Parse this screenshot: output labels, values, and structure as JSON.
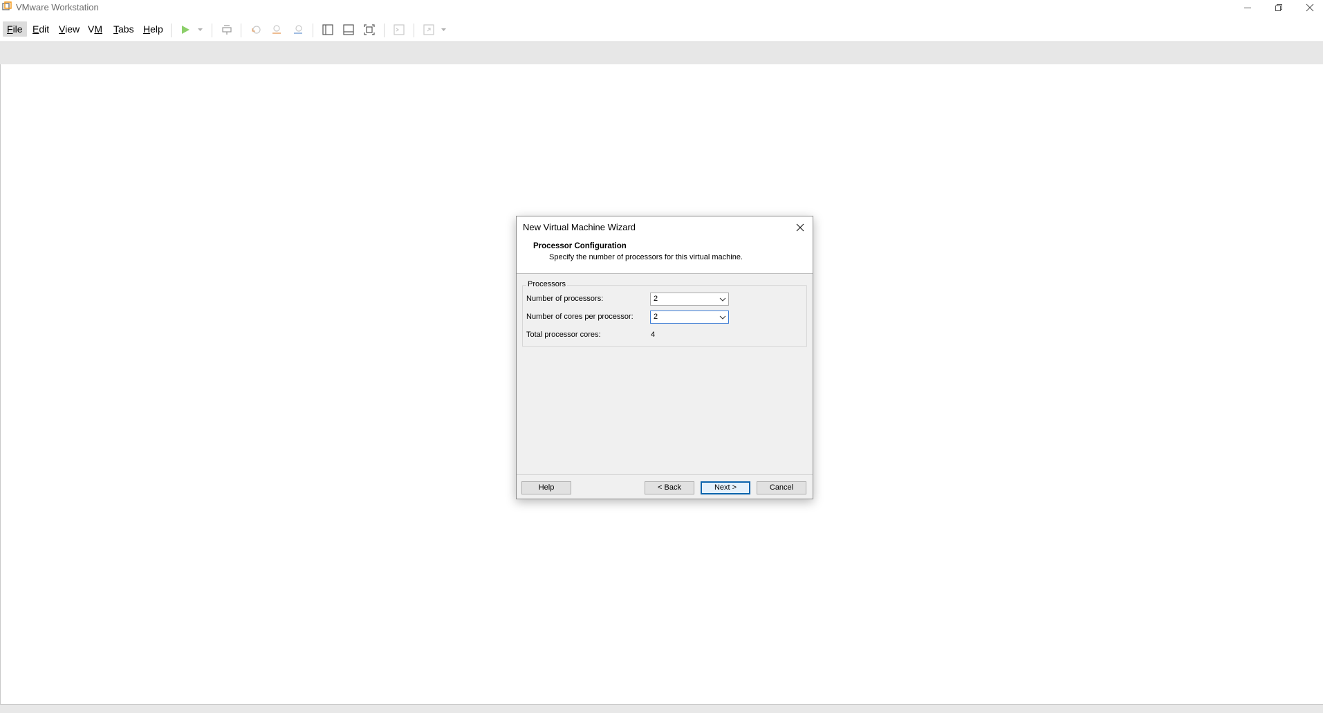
{
  "window": {
    "title": "VMware Workstation"
  },
  "menu": {
    "items": [
      {
        "label": "File",
        "mnemonic": "F",
        "rest": "ile"
      },
      {
        "label": "Edit",
        "mnemonic": "E",
        "rest": "dit"
      },
      {
        "label": "View",
        "mnemonic": "V",
        "rest": "iew"
      },
      {
        "label": "VM",
        "mnemonic": "M",
        "rest": "",
        "prefix": "V"
      },
      {
        "label": "Tabs",
        "mnemonic": "T",
        "rest": "abs"
      },
      {
        "label": "Help",
        "mnemonic": "H",
        "rest": "elp"
      }
    ]
  },
  "toolbar": {
    "icons": [
      "play-icon",
      "send-keys-icon",
      "snapshot-revert-icon",
      "snapshot-take-icon",
      "snapshot-manager-icon",
      "library-icon",
      "thumbnail-icon",
      "fullscreen-icon",
      "console-icon",
      "unity-icon"
    ],
    "accent": "#6cb33f"
  },
  "dialog": {
    "title": "New Virtual Machine Wizard",
    "heading": "Processor Configuration",
    "subheading": "Specify the number of processors for this virtual machine.",
    "group_label": "Processors",
    "fields": {
      "processors_label": "Number of processors:",
      "processors_value": "2",
      "cores_label": "Number of cores per processor:",
      "cores_value": "2",
      "total_label": "Total processor cores:",
      "total_value": "4"
    },
    "buttons": {
      "help": "Help",
      "back": "< Back",
      "next": "Next >",
      "cancel": "Cancel"
    }
  }
}
